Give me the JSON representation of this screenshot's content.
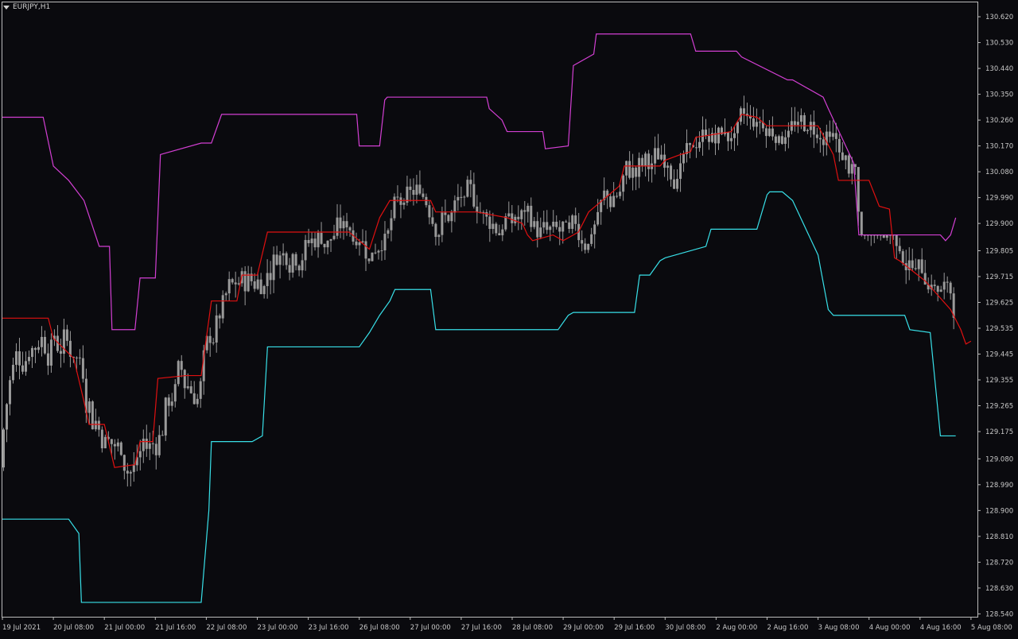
{
  "title": "EURJPY,H1",
  "colors": {
    "background": "#0a0a0e",
    "frame": "#bbbbbb",
    "axis_text": "#c8c8c8",
    "candle": "#9a9a9a",
    "upper": "#d23fd2",
    "middle": "#e01010",
    "lower": "#38e0e8"
  },
  "chart_data": {
    "type": "line",
    "title": "EURJPY,H1",
    "xlabel": "",
    "ylabel": "",
    "ylim": [
      128.53,
      130.67
    ],
    "y_ticks": [
      "130.620",
      "130.530",
      "130.440",
      "130.350",
      "130.260",
      "130.170",
      "130.080",
      "129.990",
      "129.900",
      "129.805",
      "129.715",
      "129.625",
      "129.535",
      "129.445",
      "129.355",
      "129.265",
      "129.175",
      "129.080",
      "128.990",
      "128.900",
      "128.810",
      "128.720",
      "128.630",
      "128.540"
    ],
    "x_ticks": [
      "19 Jul 2021",
      "20 Jul 08:00",
      "21 Jul 00:00",
      "21 Jul 16:00",
      "22 Jul 08:00",
      "23 Jul 00:00",
      "23 Jul 16:00",
      "26 Jul 08:00",
      "27 Jul 00:00",
      "27 Jul 16:00",
      "28 Jul 08:00",
      "29 Jul 00:00",
      "29 Jul 16:00",
      "30 Jul 08:00",
      "2 Aug 00:00",
      "2 Aug 16:00",
      "3 Aug 08:00",
      "4 Aug 00:00",
      "4 Aug 16:00",
      "5 Aug 08:00"
    ],
    "series": [
      {
        "color": "#d23fd2",
        "x": [
          0,
          0.8,
          1.0,
          1.3,
          1.6,
          1.9,
          2.1,
          2.15,
          2.6,
          2.7,
          3.0,
          3.1,
          3.9,
          4.1,
          4.3,
          6.95,
          7.0,
          7.4,
          7.5,
          7.55,
          9.5,
          9.55,
          9.8,
          9.9,
          10.6,
          10.65,
          11.1,
          11.2,
          11.6,
          11.65,
          13.5,
          13.6,
          14.4,
          14.5,
          15.4,
          15.5,
          16.1,
          16.2,
          16.7,
          16.8,
          17.1,
          17.2,
          18.4,
          18.5,
          18.6,
          18.7
        ],
        "y": [
          130.27,
          130.27,
          130.1,
          130.05,
          129.98,
          129.82,
          129.82,
          129.53,
          129.53,
          129.71,
          129.71,
          130.14,
          130.18,
          130.18,
          130.28,
          130.28,
          130.17,
          130.17,
          130.33,
          130.34,
          130.34,
          130.3,
          130.26,
          130.22,
          130.22,
          130.16,
          130.17,
          130.45,
          130.49,
          130.56,
          130.56,
          130.5,
          130.5,
          130.48,
          130.4,
          130.4,
          130.34,
          130.3,
          130.11,
          129.86,
          129.86,
          129.86,
          129.86,
          129.84,
          129.86,
          129.92
        ]
      },
      {
        "color": "#e01010",
        "x": [
          0,
          0.9,
          1.0,
          1.4,
          1.6,
          1.7,
          2.0,
          2.2,
          2.6,
          2.7,
          2.95,
          3.05,
          3.6,
          3.9,
          4.1,
          4.6,
          4.7,
          5.0,
          5.2,
          6.8,
          7.0,
          7.2,
          7.4,
          7.6,
          8.4,
          8.5,
          9.3,
          9.9,
          10.2,
          10.3,
          10.4,
          10.8,
          11.0,
          11.3,
          11.5,
          12.1,
          12.2,
          12.9,
          13.0,
          13.3,
          13.5,
          13.6,
          14.3,
          14.5,
          14.8,
          15.0,
          15.1,
          16.0,
          16.3,
          16.4,
          17.0,
          17.2,
          17.4,
          17.5,
          17.6,
          18.1,
          18.6,
          18.8,
          18.9,
          19.0
        ],
        "y": [
          129.57,
          129.57,
          129.5,
          129.43,
          129.28,
          129.2,
          129.2,
          129.05,
          129.06,
          129.14,
          129.14,
          129.36,
          129.37,
          129.37,
          129.63,
          129.63,
          129.72,
          129.72,
          129.87,
          129.87,
          129.84,
          129.81,
          129.92,
          129.98,
          129.98,
          129.94,
          129.94,
          129.92,
          129.9,
          129.86,
          129.84,
          129.86,
          129.84,
          129.87,
          129.94,
          130.03,
          130.1,
          130.1,
          130.12,
          130.14,
          130.15,
          130.2,
          130.22,
          130.28,
          130.27,
          130.24,
          130.24,
          130.24,
          130.14,
          130.05,
          130.05,
          129.96,
          129.95,
          129.78,
          129.77,
          129.7,
          129.6,
          129.53,
          129.48,
          129.49
        ]
      },
      {
        "color": "#38e0e8",
        "x": [
          0,
          1.3,
          1.5,
          1.55,
          3.9,
          4.05,
          4.1,
          4.9,
          5.1,
          5.2,
          7.0,
          7.2,
          7.4,
          7.6,
          7.7,
          8.4,
          8.5,
          9.5,
          10.9,
          11.1,
          11.2,
          12.4,
          12.5,
          12.7,
          12.9,
          13.0,
          13.8,
          13.9,
          14.8,
          15.0,
          15.05,
          15.2,
          15.3,
          15.5,
          16.0,
          16.2,
          16.3,
          16.4,
          17.7,
          17.8,
          18.2,
          18.4,
          18.7
        ],
        "y": [
          128.87,
          128.87,
          128.82,
          128.58,
          128.58,
          128.9,
          129.14,
          129.14,
          129.16,
          129.47,
          129.47,
          129.52,
          129.58,
          129.63,
          129.67,
          129.67,
          129.53,
          129.53,
          129.53,
          129.58,
          129.59,
          129.59,
          129.72,
          129.72,
          129.77,
          129.78,
          129.82,
          129.88,
          129.88,
          130.0,
          130.01,
          130.01,
          130.01,
          129.98,
          129.79,
          129.6,
          129.58,
          129.58,
          129.58,
          129.53,
          129.52,
          129.16,
          129.16
        ]
      }
    ],
    "candles_approx_price_range": [
      128.9,
      130.5
    ]
  }
}
